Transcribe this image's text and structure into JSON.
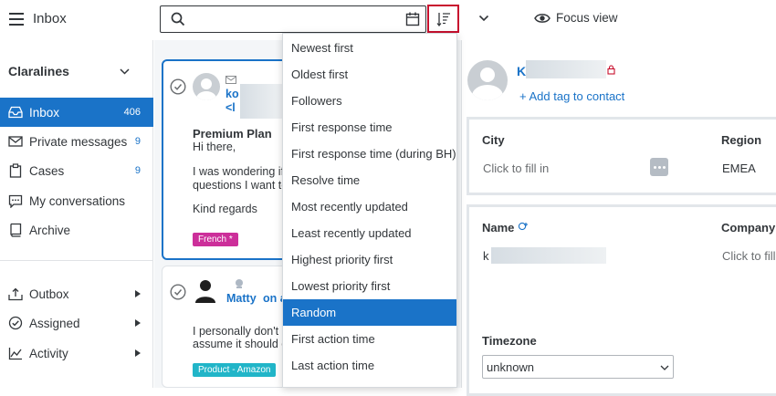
{
  "header": {
    "title": "Inbox",
    "focus_view_label": "Focus view"
  },
  "sidebar": {
    "workspace": "Claralines",
    "items": [
      {
        "label": "Inbox",
        "count": "406"
      },
      {
        "label": "Private messages",
        "count": "9"
      },
      {
        "label": "Cases",
        "count": "9"
      },
      {
        "label": "My conversations",
        "count": ""
      },
      {
        "label": "Archive",
        "count": ""
      }
    ],
    "bottom_items": [
      {
        "label": "Outbox"
      },
      {
        "label": "Assigned"
      },
      {
        "label": "Activity"
      }
    ]
  },
  "conversations": [
    {
      "name_fragment": "ko",
      "email_fragment": "<l",
      "subject": "Premium Plan",
      "line1": "Hi there,",
      "line2": "I was wondering if",
      "line3": "questions I want to",
      "line4": "Kind regards",
      "tag": "French *",
      "tag_color": "#cc2f9a"
    },
    {
      "name": "Matty",
      "name_suffix": "on a",
      "line1": "I personally don't",
      "line2": "assume it should c",
      "tag": "Product - Amazon",
      "tag_color": "#21b5c8"
    }
  ],
  "sort_menu": {
    "options": [
      "Newest first",
      "Oldest first",
      "Followers",
      "First response time",
      "First response time (during BH)",
      "Resolve time",
      "Most recently updated",
      "Least recently updated",
      "Highest priority first",
      "Lowest priority first",
      "Random",
      "First action time",
      "Last action time"
    ],
    "selected": "Random"
  },
  "contact": {
    "name_initial": "K",
    "add_tag_label": "+ Add tag to contact",
    "city_label": "City",
    "city_placeholder": "Click to fill in",
    "region_label": "Region",
    "region_value": "EMEA",
    "name_label": "Name",
    "name_value": "k",
    "company_label": "Company",
    "company_placeholder": "Click to fill",
    "timezone_label": "Timezone",
    "timezone_value": "unknown"
  },
  "colors": {
    "accent": "#1a73c8",
    "highlight_border": "#c8102e"
  }
}
